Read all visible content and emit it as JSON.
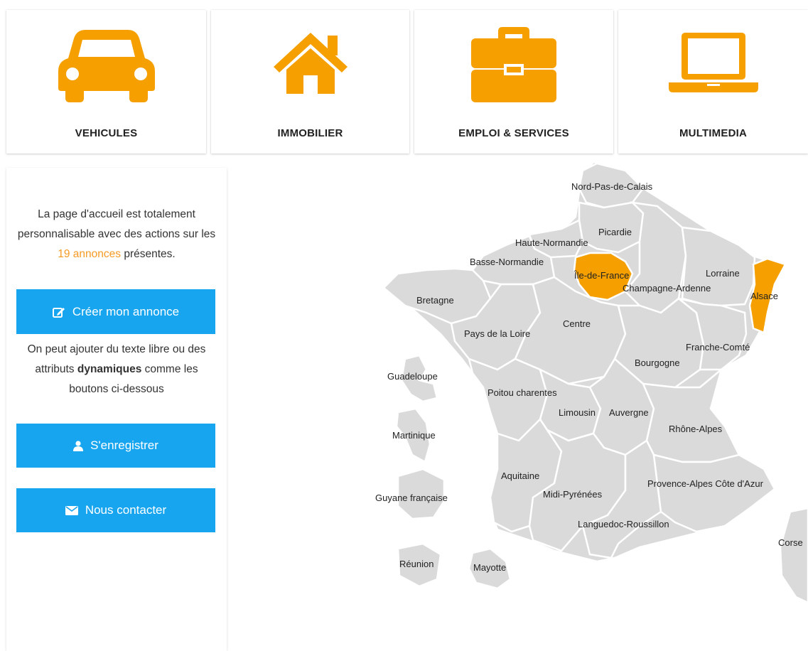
{
  "categories": [
    {
      "label": "VEHICULES",
      "icon": "car-icon"
    },
    {
      "label": "IMMOBILIER",
      "icon": "house-icon"
    },
    {
      "label": "EMPLOI & SERVICES",
      "icon": "briefcase-icon"
    },
    {
      "label": "MULTIMEDIA",
      "icon": "laptop-icon"
    }
  ],
  "sidebar": {
    "intro_before": "La page d'accueil est totalement personnalisable avec des actions sur les",
    "intro_link": "19 annonces",
    "intro_after": "présentes.",
    "create_button": "Créer mon annonce",
    "mid_before": "On peut ajouter du texte libre ou des attributs",
    "mid_bold": "dynamiques",
    "mid_after": "comme les boutons ci-dessous",
    "register_button": "S'enregistrer",
    "contact_button": "Nous contacter"
  },
  "map": {
    "active_regions": [
      "Île-de-France",
      "Alsace"
    ],
    "regions": {
      "nord_pas_de_calais": "Nord-Pas-de-Calais",
      "picardie": "Picardie",
      "haute_normandie": "Haute-Normandie",
      "basse_normandie": "Basse-Normandie",
      "ile_de_france": "Île-de-France",
      "champagne_ardenne": "Champagne-Ardenne",
      "lorraine": "Lorraine",
      "alsace": "Alsace",
      "bretagne": "Bretagne",
      "pays_de_la_loire": "Pays de la Loire",
      "centre": "Centre",
      "franche_comte": "Franche-Comté",
      "bourgogne": "Bourgogne",
      "poitou_charentes": "Poitou charentes",
      "limousin": "Limousin",
      "auvergne": "Auvergne",
      "rhone_alpes": "Rhône-Alpes",
      "aquitaine": "Aquitaine",
      "midi_pyrenees": "Midi-Pyrénées",
      "languedoc_roussillon": "Languedoc-Roussillon",
      "paca": "Provence-Alpes Côte d'Azur",
      "corse": "Corse",
      "guadeloupe": "Guadeloupe",
      "martinique": "Martinique",
      "guyane": "Guyane française",
      "reunion": "Réunion",
      "mayotte": "Mayotte"
    }
  },
  "colors": {
    "accent": "#f5a000",
    "button": "#17a5ef",
    "region": "#dadada"
  }
}
